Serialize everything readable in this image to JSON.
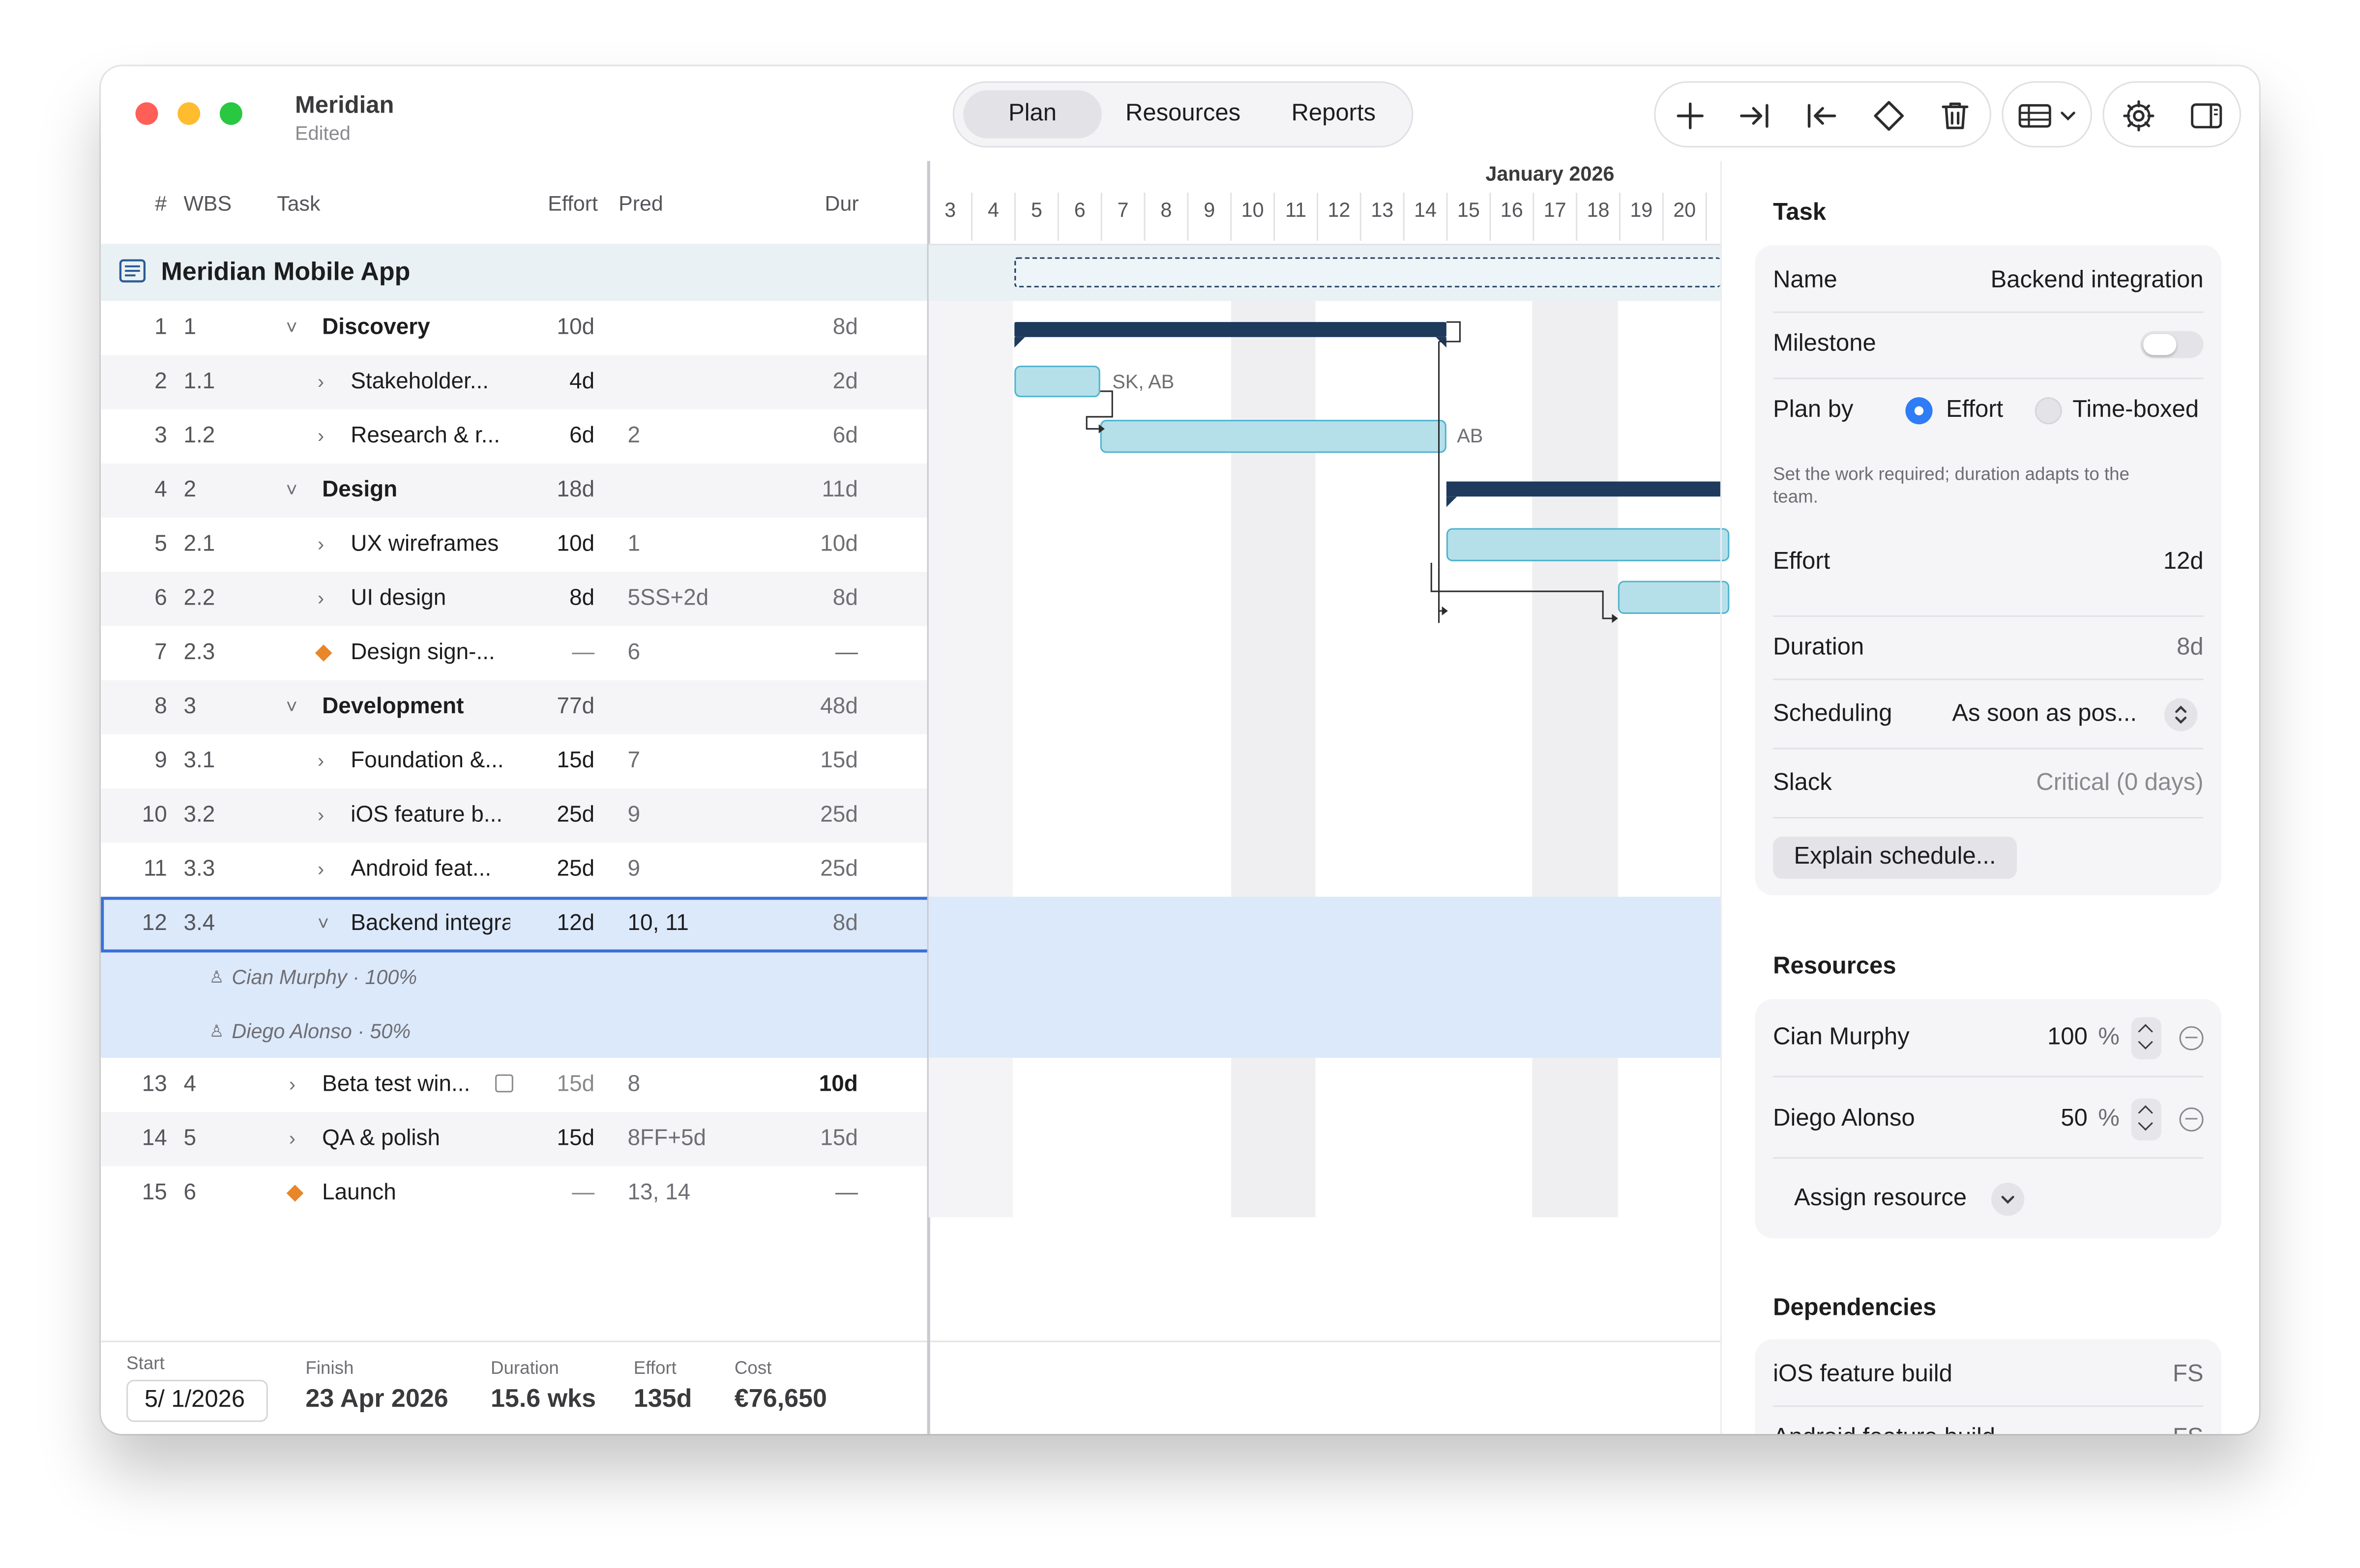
{
  "window": {
    "app_name": "Meridian",
    "status": "Edited",
    "traffic_lights": {
      "close": "#ff5f57",
      "minimize": "#febc2e",
      "zoom": "#28c840"
    }
  },
  "views": {
    "tabs": [
      {
        "label": "Plan",
        "active": true
      },
      {
        "label": "Resources",
        "active": false
      },
      {
        "label": "Reports",
        "active": false
      }
    ]
  },
  "toolbar": {
    "icons": [
      "plus-icon",
      "indent-icon",
      "outdent-icon",
      "milestone-diamond-icon",
      "trash-icon",
      "table-view-icon",
      "gear-icon",
      "sidebar-icon"
    ]
  },
  "table": {
    "headers": {
      "num": "#",
      "wbs": "WBS",
      "task": "Task",
      "effort": "Effort",
      "pred": "Pred",
      "dur": "Dur"
    },
    "project_name": "Meridian Mobile App",
    "rows": [
      {
        "num": "1",
        "wbs": "1",
        "name": "Discovery",
        "effort": "10d",
        "pred": "",
        "dur": "8d",
        "expander": "˅"
      },
      {
        "num": "2",
        "wbs": "1.1",
        "name": "Stakeholder...",
        "effort": "4d",
        "pred": "",
        "dur": "2d",
        "expander": "›"
      },
      {
        "num": "3",
        "wbs": "1.2",
        "name": "Research & r...",
        "effort": "6d",
        "pred": "2",
        "dur": "6d",
        "expander": "›"
      },
      {
        "num": "4",
        "wbs": "2",
        "name": "Design",
        "effort": "18d",
        "pred": "",
        "dur": "11d",
        "expander": "˅"
      },
      {
        "num": "5",
        "wbs": "2.1",
        "name": "UX wireframes",
        "effort": "10d",
        "pred": "1",
        "dur": "10d",
        "expander": "›"
      },
      {
        "num": "6",
        "wbs": "2.2",
        "name": "UI design",
        "effort": "8d",
        "pred": "5SS+2d",
        "dur": "8d",
        "expander": "›"
      },
      {
        "num": "7",
        "wbs": "2.3",
        "name": "Design sign-...",
        "effort": "—",
        "pred": "6",
        "dur": "—"
      },
      {
        "num": "8",
        "wbs": "3",
        "name": "Development",
        "effort": "77d",
        "pred": "",
        "dur": "48d",
        "expander": "˅"
      },
      {
        "num": "9",
        "wbs": "3.1",
        "name": "Foundation &...",
        "effort": "15d",
        "pred": "7",
        "dur": "15d",
        "expander": "›"
      },
      {
        "num": "10",
        "wbs": "3.2",
        "name": "iOS feature b...",
        "effort": "25d",
        "pred": "9",
        "dur": "25d",
        "expander": "›"
      },
      {
        "num": "11",
        "wbs": "3.3",
        "name": "Android feat...",
        "effort": "25d",
        "pred": "9",
        "dur": "25d",
        "expander": "›"
      },
      {
        "num": "12",
        "wbs": "3.4",
        "name": "Backend integra",
        "effort": "12d",
        "pred": "10, 11",
        "dur": "8d",
        "expander": "˅"
      },
      {
        "num": "13",
        "wbs": "4",
        "name": "Beta test win...",
        "effort": "15d",
        "pred": "8",
        "dur": "10d",
        "expander": "›"
      },
      {
        "num": "14",
        "wbs": "5",
        "name": "QA & polish",
        "effort": "15d",
        "pred": "8FF+5d",
        "dur": "15d",
        "expander": "›"
      },
      {
        "num": "15",
        "wbs": "6",
        "name": "Launch",
        "effort": "—",
        "pred": "13, 14",
        "dur": "—"
      }
    ],
    "assignments": [
      {
        "text": "Cian Murphy · 100%"
      },
      {
        "text": "Diego Alonso · 50%"
      }
    ]
  },
  "footer": {
    "start_label": "Start",
    "start_value": "5/ 1/2026",
    "finish_label": "Finish",
    "finish_value": "23 Apr 2026",
    "duration_label": "Duration",
    "duration_value": "15.6 wks",
    "effort_label": "Effort",
    "effort_value": "135d",
    "cost_label": "Cost",
    "cost_value": "€76,650"
  },
  "gantt": {
    "month": "January 2026",
    "days": [
      "3",
      "4",
      "5",
      "6",
      "7",
      "8",
      "9",
      "10",
      "11",
      "12",
      "13",
      "14",
      "15",
      "16",
      "17",
      "18",
      "19",
      "20"
    ],
    "bar_labels": {
      "stakeholder": "SK, AB",
      "research": "AB"
    },
    "colors": {
      "summary": "#1e3a5c",
      "task_fill": "#b5e0ea",
      "task_border": "#4fb3cf",
      "selection": "#dce9fb"
    }
  },
  "inspector": {
    "task_section": "Task",
    "name_label": "Name",
    "name_value": "Backend integration",
    "milestone_label": "Milestone",
    "milestone_on": false,
    "plan_by_label": "Plan by",
    "plan_by_option1": "Effort",
    "plan_by_option2": "Time-boxed",
    "plan_by_selected": "Effort",
    "plan_by_help": "Set the work required; duration adapts to the team.",
    "effort_label": "Effort",
    "effort_value": "12d",
    "duration_label": "Duration",
    "duration_value": "8d",
    "scheduling_label": "Scheduling",
    "scheduling_value": "As soon as pos...",
    "slack_label": "Slack",
    "slack_value": "Critical (0 days)",
    "explain_button": "Explain schedule...",
    "resources_section": "Resources",
    "resources": [
      {
        "name": "Cian Murphy",
        "percent": "100",
        "unit": "%"
      },
      {
        "name": "Diego Alonso",
        "percent": "50",
        "unit": "%"
      }
    ],
    "assign_button": "Assign resource",
    "dependencies_section": "Dependencies",
    "dependencies": [
      {
        "name": "iOS feature build",
        "type": "FS"
      },
      {
        "name": "Android feature build",
        "type": "FS"
      }
    ]
  }
}
